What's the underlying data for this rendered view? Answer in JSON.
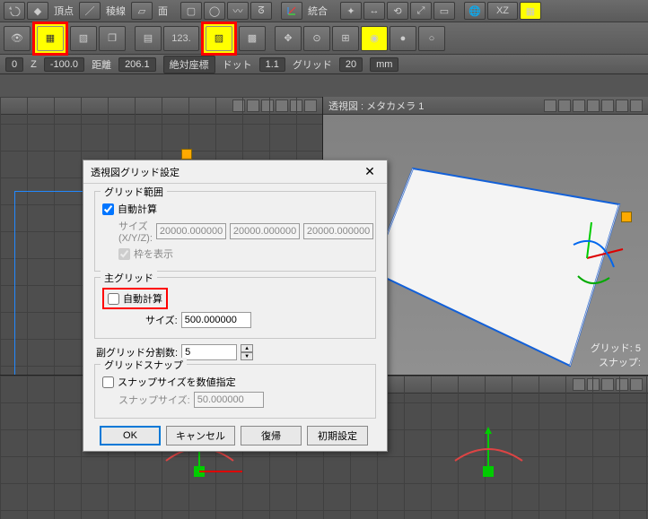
{
  "toolbar1": {
    "vertex_label": "頂点",
    "edge_label": "稜線",
    "face_label": "面",
    "integrate_label": "統合",
    "xz_label": "XZ"
  },
  "toolbar2": {
    "num_label": "123."
  },
  "status": {
    "axis0": "0",
    "axis_z": "Z",
    "z_val": "-100.0",
    "dist_label": "距離",
    "dist_val": "206.1",
    "coord_mode": "絶対座標",
    "dot_label": "ドット",
    "dot_val": "1.1",
    "grid_label": "グリッド",
    "grid_val": "20",
    "unit": "mm"
  },
  "viewport": {
    "right_title": "透視図 : メタカメラ 1",
    "info_grid_label": "グリッド:",
    "info_grid_val": "5",
    "info_snap_label": "スナップ:"
  },
  "dialog": {
    "title": "透視図グリッド設定",
    "grid_range": "グリッド範囲",
    "auto_calc": "自動計算",
    "size_xyz_label": "サイズ (X/Y/Z):",
    "size_x": "20000.000000",
    "size_y": "20000.000000",
    "size_z": "20000.000000",
    "show_frame": "枠を表示",
    "main_grid": "主グリッド",
    "size_label": "サイズ:",
    "main_size": "500.000000",
    "sub_div_label": "副グリッド分割数:",
    "sub_div": "5",
    "grid_snap": "グリッドスナップ",
    "snap_numeric": "スナップサイズを数値指定",
    "snap_size_label": "スナップサイズ:",
    "snap_size": "50.000000",
    "ok": "OK",
    "cancel": "キャンセル",
    "revert": "復帰",
    "defaults": "初期設定"
  }
}
